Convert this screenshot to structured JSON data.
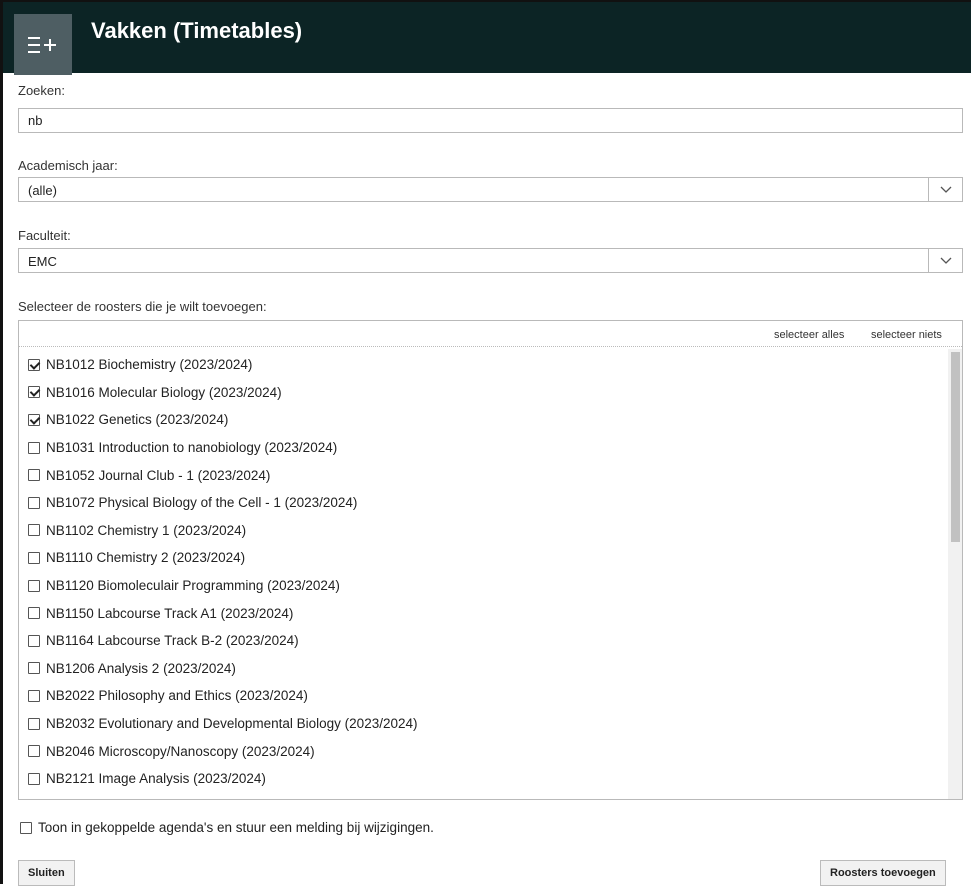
{
  "header": {
    "title": "Vakken (Timetables)",
    "menu_icon": "menu-add-icon",
    "bg_color": "#0c2425",
    "button_color": "#4e5e63"
  },
  "search": {
    "label": "Zoeken:",
    "value": "nb"
  },
  "year": {
    "label": "Academisch jaar:",
    "value": "(alle)",
    "icon": "chevron-down-icon"
  },
  "faculty": {
    "label": "Faculteit:",
    "value": "EMC",
    "icon": "chevron-down-icon"
  },
  "list": {
    "label": "Selecteer de roosters die je wilt toevoegen:",
    "select_all": "selecteer alles",
    "select_none": "selecteer niets",
    "items": [
      {
        "label": "NB1012 Biochemistry (2023/2024)",
        "checked": true
      },
      {
        "label": "NB1016 Molecular Biology (2023/2024)",
        "checked": true
      },
      {
        "label": "NB1022 Genetics (2023/2024)",
        "checked": true
      },
      {
        "label": "NB1031 Introduction to nanobiology (2023/2024)",
        "checked": false
      },
      {
        "label": "NB1052 Journal Club - 1 (2023/2024)",
        "checked": false
      },
      {
        "label": "NB1072 Physical Biology of the Cell - 1 (2023/2024)",
        "checked": false
      },
      {
        "label": "NB1102 Chemistry 1 (2023/2024)",
        "checked": false
      },
      {
        "label": "NB1110 Chemistry 2 (2023/2024)",
        "checked": false
      },
      {
        "label": "NB1120 Biomoleculair Programming (2023/2024)",
        "checked": false
      },
      {
        "label": "NB1150 Labcourse Track A1 (2023/2024)",
        "checked": false
      },
      {
        "label": "NB1164 Labcourse Track B-2 (2023/2024)",
        "checked": false
      },
      {
        "label": "NB1206 Analysis 2 (2023/2024)",
        "checked": false
      },
      {
        "label": "NB2022 Philosophy and Ethics (2023/2024)",
        "checked": false
      },
      {
        "label": "NB2032 Evolutionary and Developmental Biology (2023/2024)",
        "checked": false
      },
      {
        "label": "NB2046 Microscopy/Nanoscopy (2023/2024)",
        "checked": false
      },
      {
        "label": "NB2121 Image Analysis (2023/2024)",
        "checked": false
      }
    ]
  },
  "notify": {
    "label": "Toon in gekoppelde agenda's en stuur een melding bij wijzigingen.",
    "checked": false
  },
  "buttons": {
    "close": "Sluiten",
    "add": "Roosters toevoegen"
  }
}
